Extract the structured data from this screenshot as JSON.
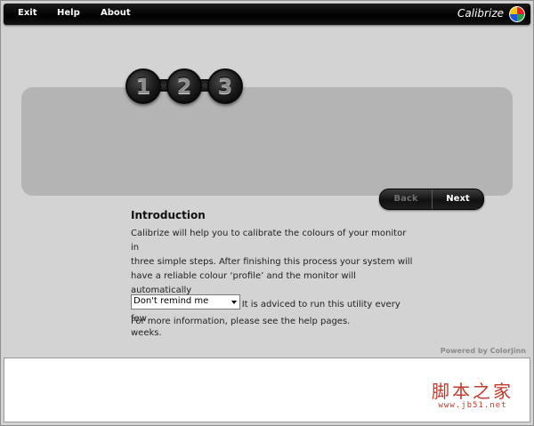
{
  "menu": {
    "exit": "Exit",
    "help": "Help",
    "about": "About"
  },
  "app": {
    "title": "Calibrize",
    "logo_icon": "colorwheel-logo-icon",
    "logo_colors": [
      "#e32222",
      "#2aa043",
      "#1f56d6",
      "#f1c40f"
    ]
  },
  "steps": {
    "items": [
      "1",
      "2",
      "3"
    ],
    "current": 1
  },
  "nav": {
    "back_label": "Back",
    "next_label": "Next",
    "back_enabled": false
  },
  "intro": {
    "heading": "Introduction",
    "lines": [
      "Calibrize will help you to calibrate the colours of your monitor in",
      "three simple steps. After finishing this process your system will",
      "have a reliable colour ‘profile’ and the monitor will automatically",
      "be adjusted accordingly. It is adviced to run this utility every few",
      "weeks."
    ],
    "reminder_select": {
      "selected": "Don't remind me"
    },
    "more_info": "For more information, please see the help pages."
  },
  "footer": {
    "powered_by": "Powered by Colorjinn"
  },
  "watermark": {
    "text": "脚本之家",
    "url": "www.jb51.net"
  }
}
